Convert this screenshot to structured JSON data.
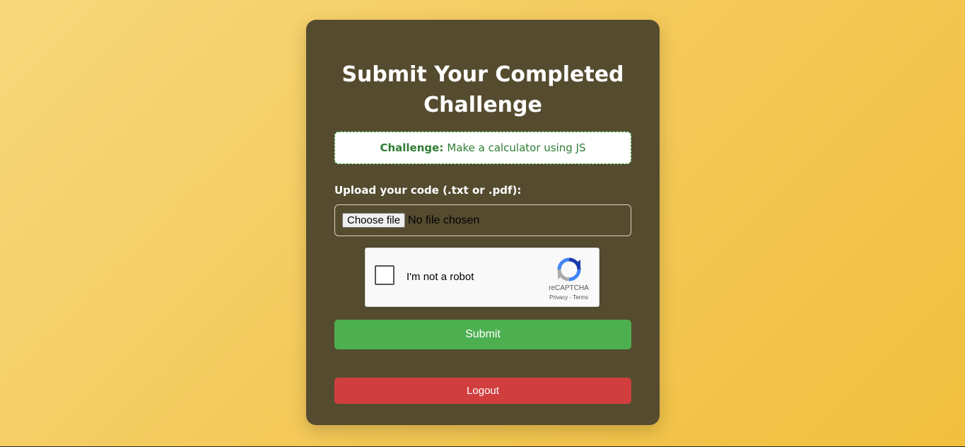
{
  "page": {
    "title_line1": "Submit Your Completed",
    "title_line2": "Challenge"
  },
  "challenge": {
    "label": "Challenge:",
    "text": "Make a calculator using JS"
  },
  "upload": {
    "label": "Upload your code (.txt or .pdf):",
    "choose_button": "Choose file",
    "status": "No file chosen"
  },
  "recaptcha": {
    "label": "I'm not a robot",
    "brand": "reCAPTCHA",
    "privacy": "Privacy",
    "separator": " - ",
    "terms": "Terms",
    "icon": "recaptcha-logo-icon"
  },
  "actions": {
    "submit": "Submit",
    "logout": "Logout"
  },
  "colors": {
    "card_bg": "#554c30",
    "submit_bg": "#4caf50",
    "logout_bg": "#d13e3e",
    "challenge_text": "#2e7d32"
  }
}
